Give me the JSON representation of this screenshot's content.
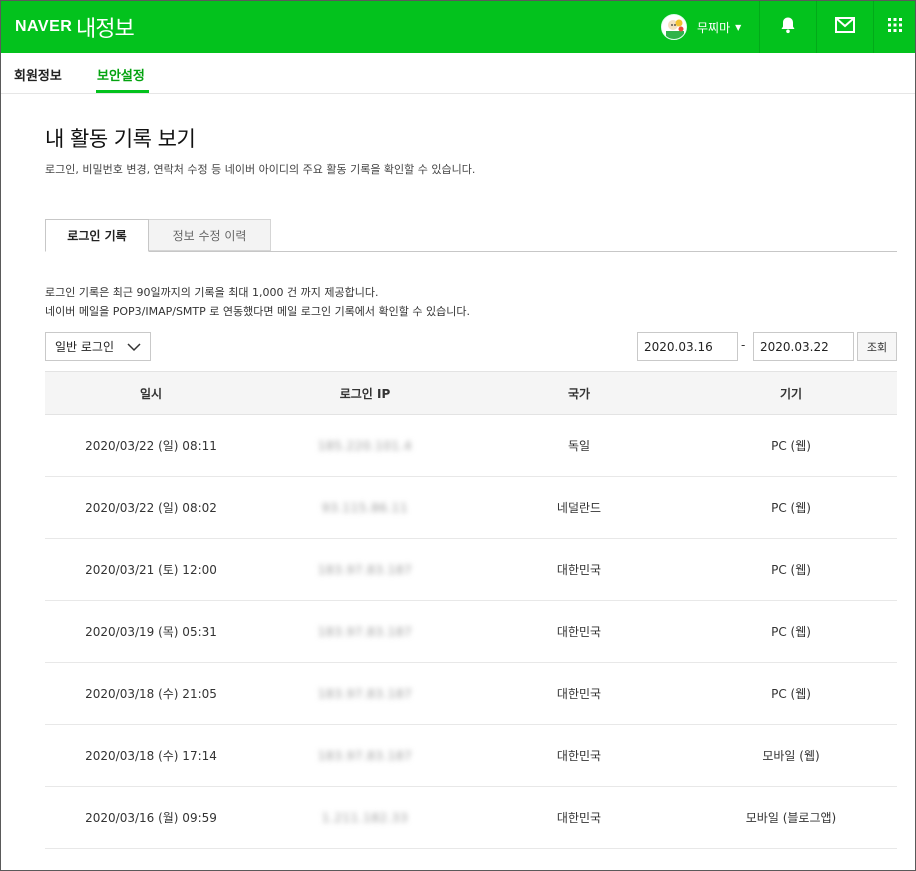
{
  "header": {
    "brand": "NAVER",
    "service_title": "내정보",
    "username": "무찌마",
    "icons": [
      "bell-icon",
      "mail-icon",
      "apps-grid-icon"
    ],
    "accent_color": "#03c21d"
  },
  "subnav": {
    "items": [
      {
        "label": "회원정보",
        "active": false
      },
      {
        "label": "보안설정",
        "active": true
      }
    ]
  },
  "main": {
    "title": "내 활동 기록 보기",
    "description": "로그인, 비밀번호 변경, 연락처 수정 등 네이버 아이디의 주요 활동 기록을 확인할 수 있습니다.",
    "tabs": [
      {
        "label": "로그인 기록",
        "active": true
      },
      {
        "label": "정보 수정 이력",
        "active": false
      }
    ],
    "notice_lines": [
      "로그인 기록은 최근 90일까지의 기록을 최대 1,000 건 까지 제공합니다.",
      "네이버 메일을 POP3/IMAP/SMTP 로 연동했다면 메일 로그인 기록에서 확인할 수 있습니다."
    ],
    "filter": {
      "login_type": "일반 로그인",
      "date_from": "2020.03.16",
      "date_separator": "-",
      "date_to": "2020.03.22",
      "search_label": "조회"
    },
    "table": {
      "columns": [
        "일시",
        "로그인 IP",
        "국가",
        "기기"
      ],
      "rows": [
        [
          "2020/03/22 (일) 08:11",
          "185.220.101.4",
          "독일",
          "PC (웹)"
        ],
        [
          "2020/03/22 (일) 08:02",
          "93.115.86.11",
          "네덜란드",
          "PC (웹)"
        ],
        [
          "2020/03/21 (토) 12:00",
          "183.97.83.187",
          "대한민국",
          "PC (웹)"
        ],
        [
          "2020/03/19 (목) 05:31",
          "183.97.83.187",
          "대한민국",
          "PC (웹)"
        ],
        [
          "2020/03/18 (수) 21:05",
          "183.97.83.187",
          "대한민국",
          "PC (웹)"
        ],
        [
          "2020/03/18 (수) 17:14",
          "183.97.83.187",
          "대한민국",
          "모바일 (웹)"
        ],
        [
          "2020/03/16 (월) 09:59",
          "1.211.182.33",
          "대한민국",
          "모바일 (블로그앱)"
        ]
      ]
    }
  }
}
